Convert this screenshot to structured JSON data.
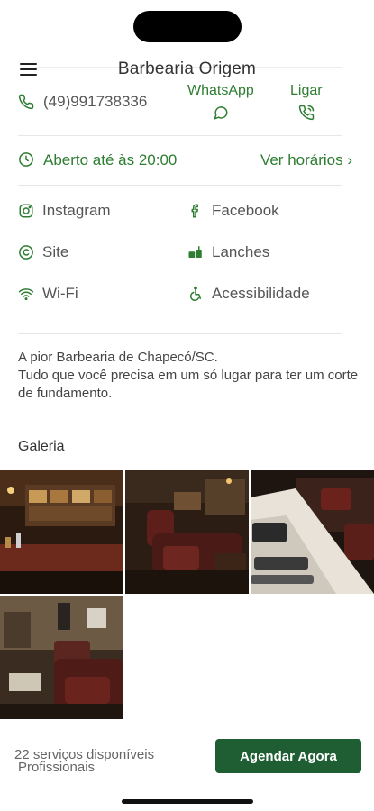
{
  "header": {
    "title": "Barbearia Origem"
  },
  "contact": {
    "phone": "(49)991738336",
    "whatsapp_label": "WhatsApp",
    "call_label": "Ligar"
  },
  "hours": {
    "status": "Aberto até às 20:00",
    "link_label": "Ver horários ›"
  },
  "links": {
    "instagram": "Instagram",
    "facebook": "Facebook",
    "site": "Site",
    "snacks": "Lanches",
    "wifi": "Wi-Fi",
    "accessibility": "Acessibilidade"
  },
  "description": {
    "line1": "A pior Barbearia de Chapecó/SC.",
    "line2": "Tudo que você precisa em um só lugar para ter um corte de fundamento."
  },
  "gallery": {
    "title": "Galeria",
    "photo_count": 4
  },
  "footer": {
    "services_count": "22 serviços disponíveis",
    "professionals": "Profissionais",
    "cta_label": "Agendar Agora"
  },
  "colors": {
    "accent": "#2e7d32",
    "cta": "#1f5e33"
  }
}
